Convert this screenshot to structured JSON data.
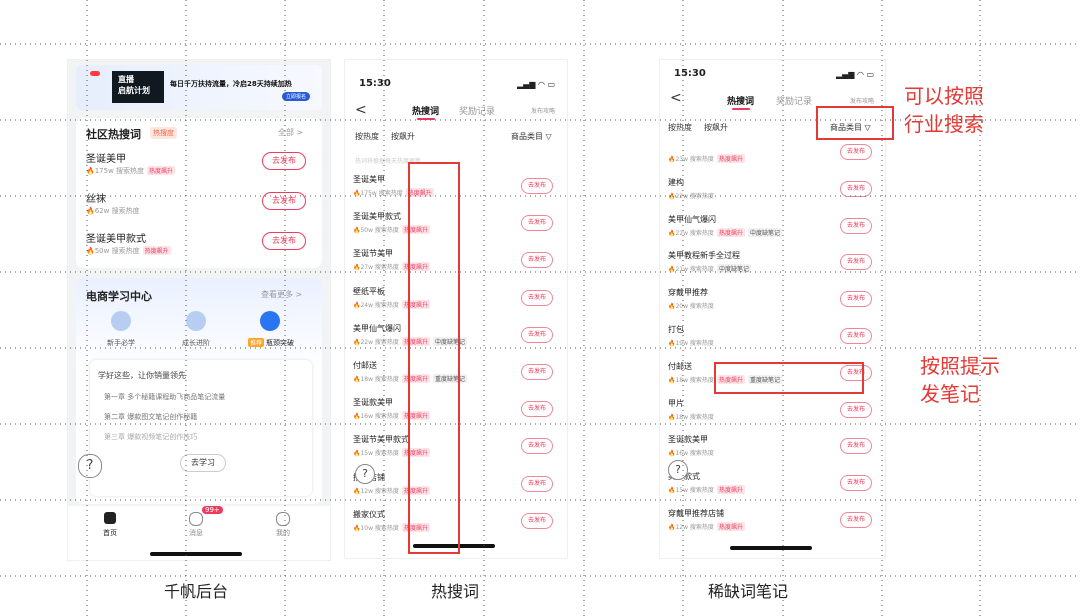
{
  "captions": [
    "千帆后台",
    "热搜词",
    "稀缺词笔记"
  ],
  "phone1": {
    "banner": {
      "title_line1": "直播",
      "title_line2": "启航计划",
      "message": "每日千万扶持流量，冷启28天持续加热",
      "button": "立即报名"
    },
    "community": {
      "title": "社区热搜词",
      "tag": "热搜度",
      "more": "全部 >",
      "items": [
        {
          "keyword": "圣诞美甲",
          "heat": "175w 搜索热度",
          "tag": "热度飙升",
          "button": "去发布"
        },
        {
          "keyword": "丝袜",
          "heat": "62w 搜索热度",
          "tag": "",
          "button": "去发布"
        },
        {
          "keyword": "圣诞美甲款式",
          "heat": "50w 搜索热度",
          "tag": "热度飙升",
          "button": "去发布"
        }
      ]
    },
    "learning": {
      "title": "电商学习中心",
      "more": "查看更多 >",
      "tabs": [
        {
          "label": "新手必学",
          "badge": ""
        },
        {
          "label": "成长进阶",
          "badge": ""
        },
        {
          "label": "瓶颈突破",
          "badge": "推荐"
        }
      ],
      "intro": "学好这些，让你销量领先",
      "chapters": [
        "第一章 多个秘籍课程助飞商品笔记流量",
        "第二章 爆款图文笔记创作秘籍",
        "第三章 爆款视频笔记创作技巧"
      ],
      "button": "去学习"
    },
    "tabbar": {
      "items": [
        {
          "label": "首页",
          "icon": "home-icon"
        },
        {
          "label": "消息",
          "icon": "message-icon",
          "badge": "99+"
        },
        {
          "label": "我的",
          "icon": "profile-icon"
        }
      ]
    }
  },
  "phone2": {
    "time": "15:30",
    "signal": "▂▄▆ ◠ ▭",
    "back": "<",
    "tabs": [
      "热搜词",
      "奖励记录",
      "发布攻略"
    ],
    "filters": [
      "按热度",
      "按飙升"
    ],
    "category": "商品类目 ▽",
    "hint": "热词将根据每天热度更新",
    "button_label": "去发布",
    "items": [
      {
        "keyword": "圣诞美甲",
        "heat": "175w 搜索热度",
        "tags": [
          "热度飙升"
        ]
      },
      {
        "keyword": "圣诞美甲款式",
        "heat": "50w 搜索热度",
        "tags": [
          "热度飙升"
        ]
      },
      {
        "keyword": "圣诞节美甲",
        "heat": "27w 搜索热度",
        "tags": [
          "热度飙升"
        ]
      },
      {
        "keyword": "壁纸平板",
        "heat": "24w 搜索热度",
        "tags": [
          "热度飙升"
        ]
      },
      {
        "keyword": "美甲仙气爆闪",
        "heat": "22w 搜索热度",
        "tags": [
          "热度飙升",
          "中度缺笔记"
        ]
      },
      {
        "keyword": "付邮送",
        "heat": "18w 搜索热度",
        "tags": [
          "热度飙升",
          "重度缺笔记"
        ]
      },
      {
        "keyword": "圣诞款美甲",
        "heat": "16w 搜索热度",
        "tags": [
          "热度飙升"
        ]
      },
      {
        "keyword": "圣诞节美甲款式",
        "heat": "15w 搜索热度",
        "tags": [
          "热度飙升"
        ]
      },
      {
        "keyword": "推荐店铺",
        "heat": "12w 搜索热度",
        "tags": [
          "热度飙升"
        ]
      },
      {
        "keyword": "搬家仪式",
        "heat": "10w 搜索热度",
        "tags": [
          "热度飙升"
        ]
      }
    ]
  },
  "phone3": {
    "time": "15:30",
    "signal": "▂▄▆ ◠ ▭",
    "back": "<",
    "tabs": [
      "热搜词",
      "奖励记录",
      "发布攻略"
    ],
    "filters": [
      "按热度",
      "按飙升"
    ],
    "category": "商品类目 ▽",
    "button_label": "去发布",
    "items": [
      {
        "keyword": "",
        "heat": "23w 搜索热度",
        "tags": [
          "热度飙升"
        ]
      },
      {
        "keyword": "建构",
        "heat": "22w 搜索热度",
        "tags": []
      },
      {
        "keyword": "美甲仙气爆闪",
        "heat": "22w 搜索热度",
        "tags": [
          "热度飙升",
          "中度缺笔记"
        ]
      },
      {
        "keyword": "美甲教程新手全过程",
        "heat": "21w 搜索热度",
        "tags": [
          "中度缺笔记"
        ]
      },
      {
        "keyword": "穿戴甲推荐",
        "heat": "20w 搜索热度",
        "tags": []
      },
      {
        "keyword": "打包",
        "heat": "19w 搜索热度",
        "tags": []
      },
      {
        "keyword": "付邮送",
        "heat": "18w 搜索热度",
        "tags": [
          "热度飙升",
          "重度缺笔记"
        ]
      },
      {
        "keyword": "甲片",
        "heat": "18w 搜索热度",
        "tags": []
      },
      {
        "keyword": "圣诞款美甲",
        "heat": "16w 搜索热度",
        "tags": []
      },
      {
        "keyword": "美甲款式",
        "heat": "15w 搜索热度",
        "tags": [
          "热度飙升"
        ]
      },
      {
        "keyword": "穿戴甲推荐店铺",
        "heat": "12w 搜索热度",
        "tags": [
          "热度飙升"
        ]
      }
    ]
  },
  "annotations": {
    "industry": "可以按照\n行业搜索",
    "hint": "按照提示\n发笔记"
  },
  "colors": {
    "accent_red": "#ee3a5b",
    "annotation_red": "#e53935",
    "learn_blue": "#2a76f0"
  }
}
